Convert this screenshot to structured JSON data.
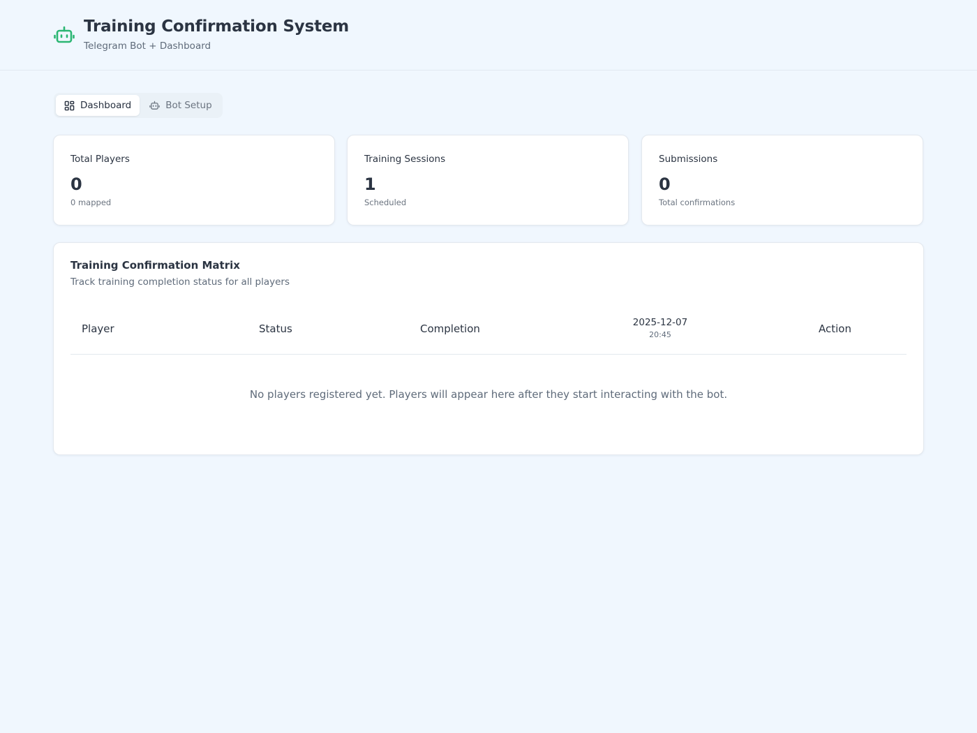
{
  "header": {
    "title": "Training Confirmation System",
    "subtitle": "Telegram Bot + Dashboard",
    "logo_icon": "bot-icon",
    "accent_color": "#2bb673"
  },
  "tabs": [
    {
      "label": "Dashboard",
      "icon": "dashboard-grid-icon",
      "active": true
    },
    {
      "label": "Bot Setup",
      "icon": "bot-icon",
      "active": false
    }
  ],
  "stats": [
    {
      "label": "Total Players",
      "value": "0",
      "note": "0 mapped"
    },
    {
      "label": "Training Sessions",
      "value": "1",
      "note": "Scheduled"
    },
    {
      "label": "Submissions",
      "value": "0",
      "note": "Total confirmations"
    }
  ],
  "matrix": {
    "title": "Training Confirmation Matrix",
    "subtitle": "Track training completion status for all players",
    "columns": {
      "player": "Player",
      "status": "Status",
      "completion": "Completion",
      "session_date": "2025-12-07",
      "session_time": "20:45",
      "action": "Action"
    },
    "empty_message": "No players registered yet. Players will appear here after they start interacting with the bot."
  }
}
